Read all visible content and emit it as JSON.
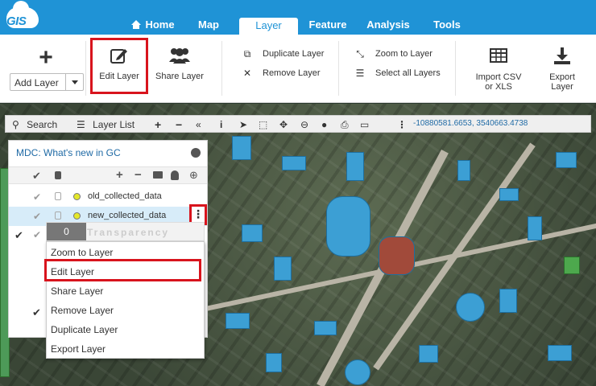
{
  "logo": {
    "text": "GIS"
  },
  "nav": {
    "tabs": [
      "Home",
      "Map",
      "Layer",
      "Feature",
      "Analysis",
      "Tools"
    ],
    "active": "Layer"
  },
  "ribbon": {
    "add_layer": "Add Layer",
    "edit_layer": "Edit Layer",
    "share_layer": "Share Layer",
    "duplicate_layer": "Duplicate Layer",
    "remove_layer": "Remove Layer",
    "zoom_to_layer": "Zoom to Layer",
    "select_all_layers": "Select all Layers",
    "import_csv_line1": "Import CSV",
    "import_csv_line2": "or XLS",
    "export_line1": "Export",
    "export_line2": "Layer"
  },
  "map_toolbar": {
    "search": "Search",
    "layer_list": "Layer List",
    "coordinates": "-10880581.6653, 3540663.4738"
  },
  "panel": {
    "title": "MDC: What's new in GC",
    "layers": [
      {
        "name": "old_collected_data",
        "selected": false
      },
      {
        "name": "new_collected_data",
        "selected": true
      }
    ]
  },
  "transparency": {
    "value": "0",
    "label": "Transparency"
  },
  "context_menu": {
    "items": [
      "Zoom to Layer",
      "Edit Layer",
      "Share Layer",
      "Remove Layer",
      "Duplicate Layer",
      "Export Layer"
    ],
    "highlighted": "Edit Layer"
  },
  "colors": {
    "nav": "#1f93d6",
    "highlight": "#d8141d",
    "building": "#3c9fd4"
  }
}
